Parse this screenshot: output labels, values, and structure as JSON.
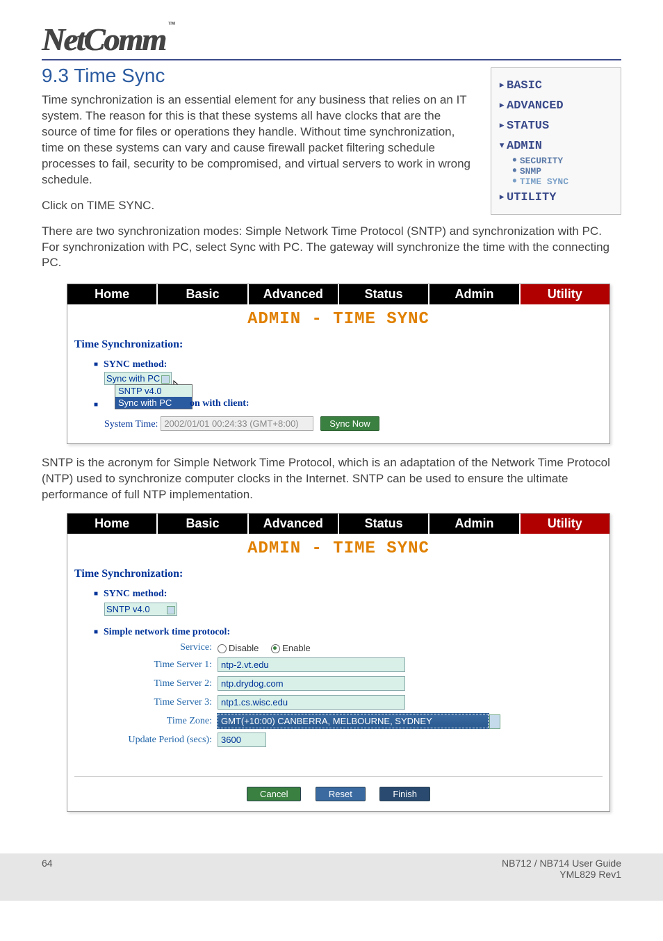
{
  "brand": {
    "name": "NetComm",
    "tm": "™"
  },
  "section": {
    "title": "9.3 Time Sync"
  },
  "paragraphs": {
    "p1": "Time synchronization is an essential element for any business that relies on an IT system. The reason for this is that these systems all have clocks that are the source of time for files or operations they handle. Without time synchronization, time on these systems can vary and cause firewall packet filtering schedule processes to fail, security to be compromised, and virtual servers to work in wrong schedule.",
    "p2": "Click on TIME SYNC.",
    "p3": "There are two synchronization modes: Simple Network Time Protocol (SNTP) and synchronization with PC. For synchronization with PC, select Sync with PC. The gateway will synchronize the time with the connecting PC.",
    "p4": "SNTP is the acronym for Simple Network Time Protocol, which is an adaptation of the Network Time Protocol (NTP) used to synchronize computer clocks in the Internet. SNTP can be used to ensure the ultimate performance of full NTP implementation."
  },
  "nav": {
    "basic": "BASIC",
    "advanced": "ADVANCED",
    "status": "STATUS",
    "admin": "ADMIN",
    "security": "SECURITY",
    "snmp": "SNMP",
    "timesync": "TIME SYNC",
    "utility": "UTILITY"
  },
  "tabs": {
    "home": "Home",
    "basic": "Basic",
    "advanced": "Advanced",
    "status": "Status",
    "admin": "Admin",
    "utility": "Utility"
  },
  "panel": {
    "heading": "ADMIN - TIME SYNC",
    "time_sync_label": "Time Synchronization:",
    "sync_method_label": "SYNC method:",
    "dropdown_selected": "Sync with PC",
    "option_sntp": "SNTP v4.0",
    "option_syncpc": "Sync with PC",
    "overlay": "on with client:",
    "system_time_label": "System Time:",
    "system_time_value": "2002/01/01 00:24:33 (GMT+8:00)",
    "sync_now_btn": "Sync Now"
  },
  "panel2": {
    "sync_method_value": "SNTP v4.0",
    "sntp_label": "Simple network time protocol:",
    "service_label": "Service:",
    "disable": "Disable",
    "enable": "Enable",
    "ts1_label": "Time Server 1:",
    "ts1_value": "ntp-2.vt.edu",
    "ts2_label": "Time Server 2:",
    "ts2_value": "ntp.drydog.com",
    "ts3_label": "Time Server 3:",
    "ts3_value": "ntp1.cs.wisc.edu",
    "tz_label": "Time Zone:",
    "tz_value": "GMT(+10:00) CANBERRA, MELBOURNE, SYDNEY",
    "upd_label": "Update Period (secs):",
    "upd_value": "3600",
    "cancel": "Cancel",
    "reset": "Reset",
    "finish": "Finish"
  },
  "footer": {
    "page": "64",
    "guide": "NB712 / NB714 User Guide",
    "rev": "YML829 Rev1"
  }
}
